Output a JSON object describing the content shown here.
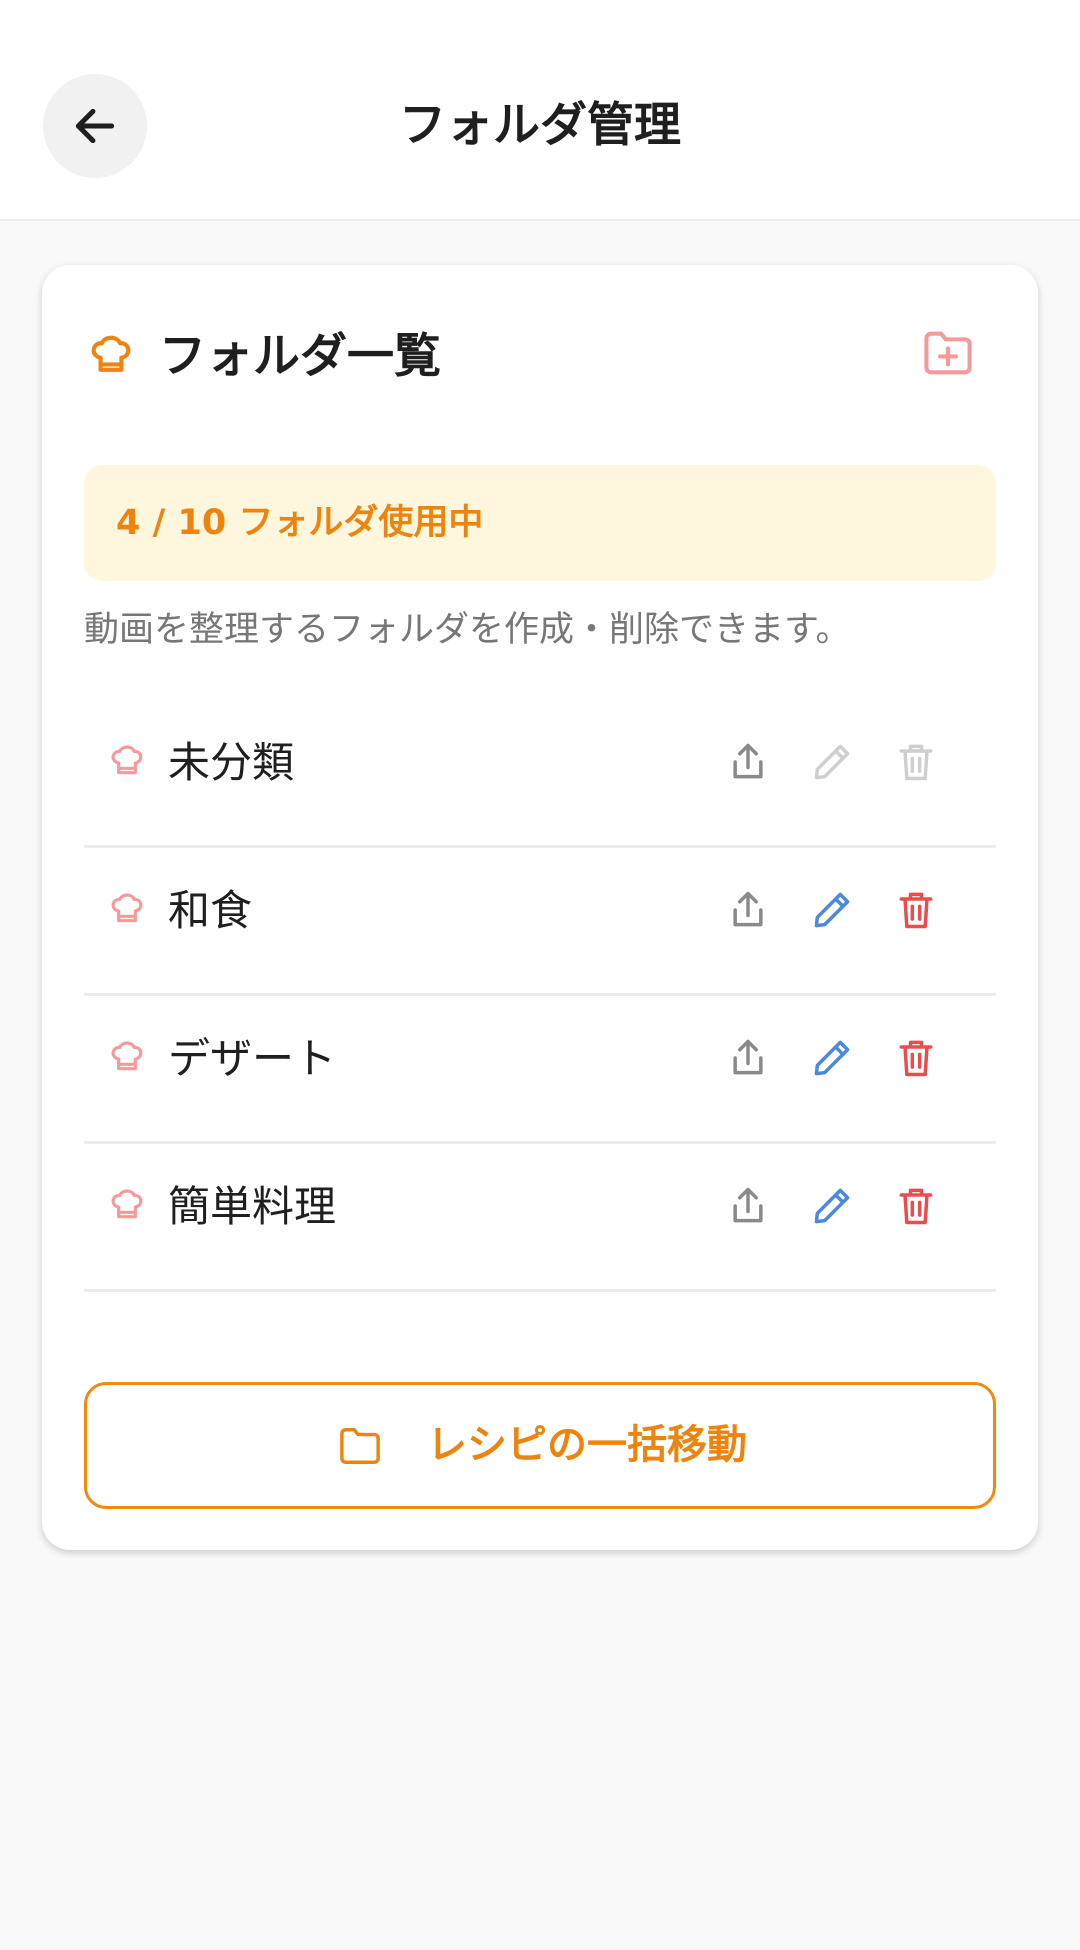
{
  "header": {
    "title": "フォルダ管理",
    "back_icon": "arrow-left-icon"
  },
  "card": {
    "title": "フォルダ一覧",
    "head_icon": "chef-hat-icon",
    "add_icon": "folder-plus-icon",
    "usage": "4 / 10 フォルダ使用中",
    "description": "動画を整理するフォルダを作成・削除できます。"
  },
  "folders": [
    {
      "name": "未分類",
      "editable": false
    },
    {
      "name": "和食",
      "editable": true
    },
    {
      "name": "デザート",
      "editable": true
    },
    {
      "name": "簡単料理",
      "editable": true
    }
  ],
  "bulk_move": {
    "label": "レシピの一括移動",
    "icon": "folder-icon"
  },
  "colors": {
    "accent": "#ee8410",
    "banner": "#fef7dd",
    "folder_icon": "#f59a9a",
    "edit": "#4a89dc",
    "delete": "#ea4d4d",
    "share": "#8a8a8a",
    "disabled": "#cfcfcf"
  }
}
